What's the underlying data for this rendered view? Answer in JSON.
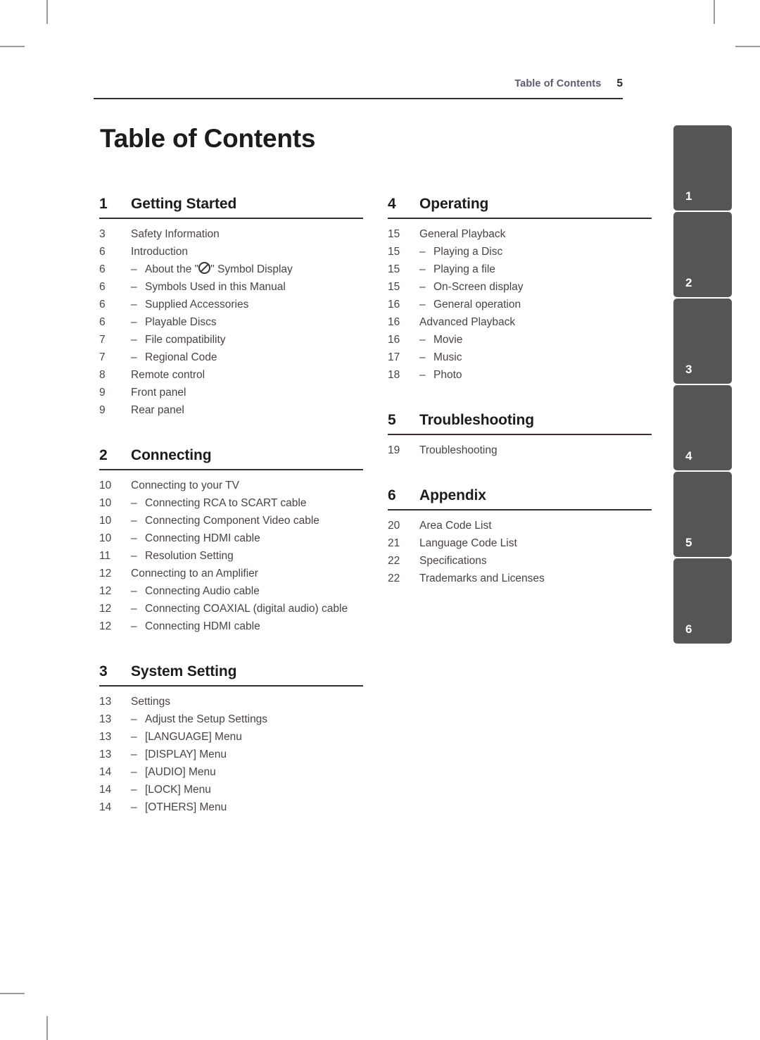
{
  "header": {
    "title": "Table of Contents",
    "page_number": "5"
  },
  "page_title": "Table of Contents",
  "columns": {
    "left": [
      {
        "number": "1",
        "name": "Getting Started",
        "entries": [
          {
            "page": "3",
            "text": "Safety Information",
            "sub": false
          },
          {
            "page": "6",
            "text": "Introduction",
            "sub": false
          },
          {
            "page": "6",
            "text": "About the \"⊘\" Symbol Display",
            "sub": true,
            "symbol": true,
            "text_before": "About the \"",
            "text_after": "\" Symbol Display"
          },
          {
            "page": "6",
            "text": "Symbols Used in this Manual",
            "sub": true
          },
          {
            "page": "6",
            "text": "Supplied Accessories",
            "sub": true
          },
          {
            "page": "6",
            "text": "Playable Discs",
            "sub": true
          },
          {
            "page": "7",
            "text": "File compatibility",
            "sub": true
          },
          {
            "page": "7",
            "text": "Regional Code",
            "sub": true
          },
          {
            "page": "8",
            "text": "Remote control",
            "sub": false
          },
          {
            "page": "9",
            "text": "Front panel",
            "sub": false
          },
          {
            "page": "9",
            "text": "Rear panel",
            "sub": false
          }
        ]
      },
      {
        "number": "2",
        "name": "Connecting",
        "entries": [
          {
            "page": "10",
            "text": "Connecting to your TV",
            "sub": false
          },
          {
            "page": "10",
            "text": "Connecting RCA to SCART cable",
            "sub": true
          },
          {
            "page": "10",
            "text": "Connecting Component Video cable",
            "sub": true
          },
          {
            "page": "10",
            "text": "Connecting HDMI cable",
            "sub": true
          },
          {
            "page": "11",
            "text": "Resolution Setting",
            "sub": true
          },
          {
            "page": "12",
            "text": "Connecting to an Amplifier",
            "sub": false
          },
          {
            "page": "12",
            "text": "Connecting Audio cable",
            "sub": true
          },
          {
            "page": "12",
            "text": "Connecting COAXIAL (digital audio) cable",
            "sub": true
          },
          {
            "page": "12",
            "text": "Connecting HDMI cable",
            "sub": true
          }
        ]
      },
      {
        "number": "3",
        "name": "System Setting",
        "entries": [
          {
            "page": "13",
            "text": "Settings",
            "sub": false
          },
          {
            "page": "13",
            "text": "Adjust the Setup Settings",
            "sub": true
          },
          {
            "page": "13",
            "text": "[LANGUAGE] Menu",
            "sub": true
          },
          {
            "page": "13",
            "text": "[DISPLAY] Menu",
            "sub": true
          },
          {
            "page": "14",
            "text": "[AUDIO] Menu",
            "sub": true
          },
          {
            "page": "14",
            "text": "[LOCK] Menu",
            "sub": true
          },
          {
            "page": "14",
            "text": "[OTHERS] Menu",
            "sub": true
          }
        ]
      }
    ],
    "right": [
      {
        "number": "4",
        "name": "Operating",
        "entries": [
          {
            "page": "15",
            "text": "General Playback",
            "sub": false
          },
          {
            "page": "15",
            "text": "Playing a Disc",
            "sub": true
          },
          {
            "page": "15",
            "text": "Playing a file",
            "sub": true
          },
          {
            "page": "15",
            "text": "On-Screen display",
            "sub": true
          },
          {
            "page": "16",
            "text": "General operation",
            "sub": true
          },
          {
            "page": "16",
            "text": "Advanced Playback",
            "sub": false
          },
          {
            "page": "16",
            "text": "Movie",
            "sub": true
          },
          {
            "page": "17",
            "text": "Music",
            "sub": true
          },
          {
            "page": "18",
            "text": "Photo",
            "sub": true
          }
        ]
      },
      {
        "number": "5",
        "name": "Troubleshooting",
        "entries": [
          {
            "page": "19",
            "text": "Troubleshooting",
            "sub": false
          }
        ]
      },
      {
        "number": "6",
        "name": "Appendix",
        "entries": [
          {
            "page": "20",
            "text": "Area Code List",
            "sub": false
          },
          {
            "page": "21",
            "text": "Language Code List",
            "sub": false
          },
          {
            "page": "22",
            "text": "Specifications",
            "sub": false
          },
          {
            "page": "22",
            "text": "Trademarks and Licenses",
            "sub": false
          }
        ]
      }
    ]
  },
  "side_tabs": [
    "1",
    "2",
    "3",
    "4",
    "5",
    "6"
  ],
  "colors": {
    "tab_background": "#555558",
    "header_title": "#5c5c70",
    "body_text": "#4a4246",
    "heading_text": "#1c1c1c",
    "rule": "#2e2e33",
    "crop_mark": "#9c9c9c"
  },
  "dash_glyph": "–"
}
